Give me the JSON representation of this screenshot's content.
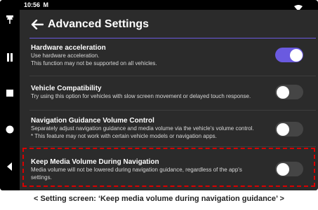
{
  "status_bar": {
    "time": "10:56",
    "indicator": "M",
    "wifi_icon": "wifi-icon"
  },
  "nav_bar": {
    "icons": [
      "pin-icon",
      "pause-icon",
      "stop-icon",
      "circle-icon",
      "back-triangle-icon"
    ]
  },
  "header": {
    "back_icon": "back-arrow-icon",
    "title": "Advanced Settings"
  },
  "settings": [
    {
      "title": "Hardware acceleration",
      "desc_lines": [
        "Use hardware acceleration.",
        "This function may not be supported on all vehicles."
      ],
      "enabled": true
    },
    {
      "title": "Vehicle Compatibility",
      "desc_lines": [
        "Try using this option for vehicles with slow screen movement or delayed touch response."
      ],
      "enabled": false
    },
    {
      "title": "Navigation Guidance Volume Control",
      "desc_lines": [
        "Separately adjust navigation guidance and media volume via the vehicle's volume control.",
        "* This feature may not work with certain vehicle models or navigation apps."
      ],
      "enabled": false
    },
    {
      "title": "Keep Media Volume During Navigation",
      "desc_lines": [
        "Media volume will not be lowered during navigation guidance, regardless of the app's",
        "settings."
      ],
      "enabled": false
    }
  ],
  "caption": "< Setting screen: ‘Keep media volume during navigation guidance’ >",
  "colors": {
    "accent": "#6a5ae0",
    "panel": "#2b2b2b",
    "highlight": "#d90000"
  }
}
